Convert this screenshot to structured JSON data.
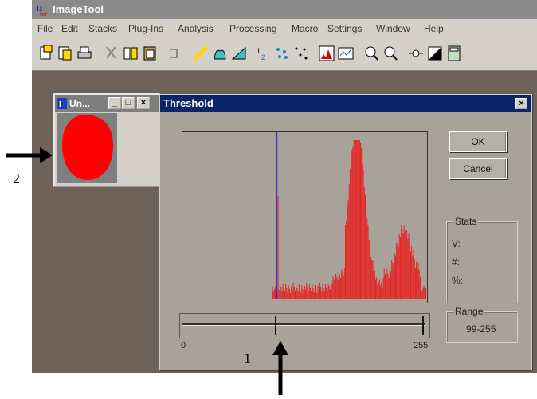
{
  "window": {
    "title": "ImageTool"
  },
  "menu": [
    "File",
    "Edit",
    "Stacks",
    "Plug-Ins",
    "Analysis",
    "Processing",
    "Macro",
    "Settings",
    "Window",
    "Help"
  ],
  "toolbar_icons": [
    "open-icon",
    "save-icon",
    "print-icon",
    "cut-icon",
    "flip-icon",
    "paste-icon",
    "undo-icon",
    "ruler-icon",
    "roi-icon",
    "angle-icon",
    "sequence-icon",
    "particles-icon",
    "points-icon",
    "histogram-icon",
    "profile-icon",
    "zoom-in-icon",
    "zoom-out-icon",
    "brightness-icon",
    "contrast-icon",
    "calculator-icon"
  ],
  "image_window": {
    "title": "Un..."
  },
  "dialog": {
    "title": "Threshold",
    "ok_label": "OK",
    "cancel_label": "Cancel",
    "stats": {
      "label": "Stats",
      "v": "V:",
      "n": "#:",
      "p": "%:"
    },
    "range": {
      "label": "Range",
      "value": "99-255"
    },
    "slider": {
      "min_label": "0",
      "max_label": "255",
      "min": 0,
      "max": 255,
      "low": 99,
      "high": 255
    }
  },
  "chart_data": {
    "type": "bar",
    "x": [
      0,
      255
    ],
    "threshold_line": 99,
    "colors": {
      "bars": "#e82020",
      "threshold": "#2020d0"
    }
  },
  "annotations": {
    "one": "1",
    "two": "2"
  }
}
